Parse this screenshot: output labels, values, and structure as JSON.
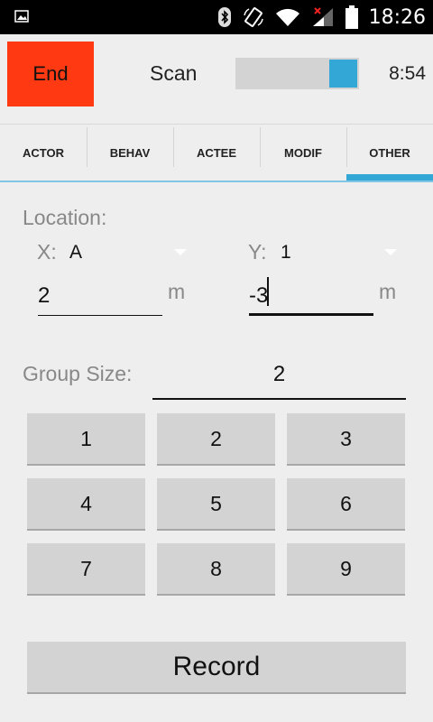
{
  "status_bar": {
    "time": "18:26",
    "icons": [
      "image-notification-icon",
      "bluetooth-icon",
      "rotate-icon",
      "wifi-icon",
      "signal-icon",
      "battery-icon"
    ]
  },
  "header": {
    "end_label": "End",
    "scan_label": "Scan",
    "scan_toggle_on": true,
    "timer": "8:54"
  },
  "tabs": [
    {
      "label": "ACTOR",
      "active": false
    },
    {
      "label": "BEHAV",
      "active": false
    },
    {
      "label": "ACTEE",
      "active": false
    },
    {
      "label": "MODIF",
      "active": false
    },
    {
      "label": "OTHER",
      "active": true
    }
  ],
  "location": {
    "title": "Location:",
    "x_label": "X:",
    "x_selected": "A",
    "y_label": "Y:",
    "y_selected": "1",
    "x_value": "2",
    "x_unit": "m",
    "y_value": "-3",
    "y_unit": "m"
  },
  "group_size": {
    "label": "Group Size:",
    "value": "2"
  },
  "keypad": {
    "keys": [
      "1",
      "2",
      "3",
      "4",
      "5",
      "6",
      "7",
      "8",
      "9"
    ]
  },
  "record_label": "Record",
  "colors": {
    "end_button": "#ff3a12",
    "accent": "#33a8d6",
    "button_gray": "#d3d3d3",
    "background": "#eeeeee"
  }
}
